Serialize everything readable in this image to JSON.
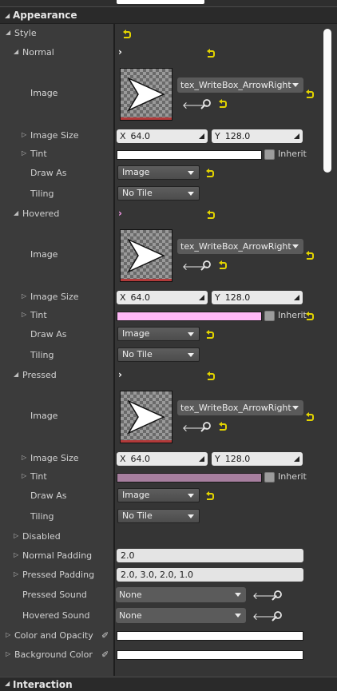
{
  "categories": {
    "appearance": "Appearance",
    "interaction": "Interaction"
  },
  "style_label": "Style",
  "states": {
    "normal": {
      "label": "Normal",
      "image_label": "Image",
      "image_asset": "tex_WriteBox_ArrowRight",
      "image_size_label": "Image Size",
      "size_x": "64.0",
      "size_y": "128.0",
      "tint_label": "Tint",
      "tint_color": "#ffffff",
      "inherit_label": "Inherit",
      "draw_as_label": "Draw As",
      "draw_as_value": "Image",
      "tiling_label": "Tiling",
      "tiling_value": "No Tile"
    },
    "hovered": {
      "label": "Hovered",
      "image_label": "Image",
      "image_asset": "tex_WriteBox_ArrowRight",
      "image_size_label": "Image Size",
      "size_x": "64.0",
      "size_y": "128.0",
      "tint_label": "Tint",
      "tint_color": "#ffb8f6",
      "inherit_label": "Inherit",
      "draw_as_label": "Draw As",
      "draw_as_value": "Image",
      "tiling_label": "Tiling",
      "tiling_value": "No Tile"
    },
    "pressed": {
      "label": "Pressed",
      "image_label": "Image",
      "image_asset": "tex_WriteBox_ArrowRight",
      "image_size_label": "Image Size",
      "size_x": "64.0",
      "size_y": "128.0",
      "tint_label": "Tint",
      "tint_color": "#a77f9f",
      "inherit_label": "Inherit",
      "draw_as_label": "Draw As",
      "draw_as_value": "Image",
      "tiling_label": "Tiling",
      "tiling_value": "No Tile"
    }
  },
  "axis_x": "X",
  "axis_y": "Y",
  "disabled_label": "Disabled",
  "normal_padding": {
    "label": "Normal Padding",
    "value": "2.0"
  },
  "pressed_padding": {
    "label": "Pressed Padding",
    "value": "2.0, 3.0, 2.0, 1.0"
  },
  "pressed_sound": {
    "label": "Pressed Sound",
    "value": "None"
  },
  "hovered_sound": {
    "label": "Hovered Sound",
    "value": "None"
  },
  "color_and_opacity": {
    "label": "Color and Opacity",
    "color": "#ffffff"
  },
  "background_color": {
    "label": "Background Color",
    "color": "#ffffff"
  },
  "colors": {
    "reset_arrow": "#e3d400",
    "hover_chevron": "#ff9cf0"
  }
}
